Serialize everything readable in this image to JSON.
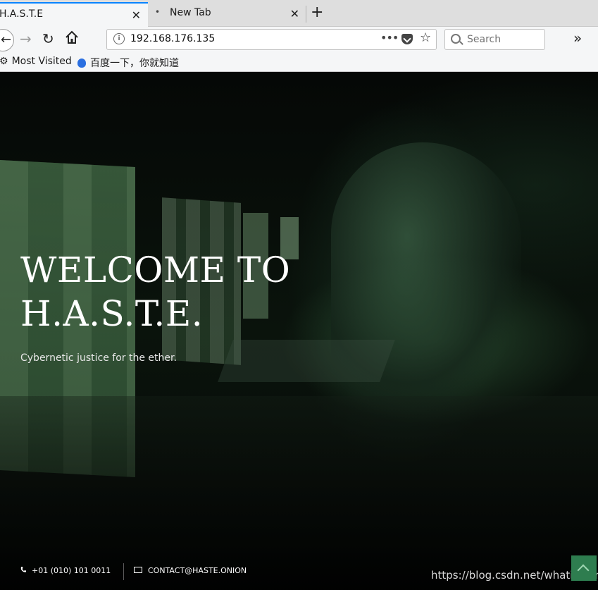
{
  "browser": {
    "tabs": [
      {
        "title": "H.A.S.T.E",
        "close": "✕"
      },
      {
        "title": "New Tab",
        "close": "✕",
        "indicator": "•"
      }
    ],
    "new_tab": "+",
    "nav": {
      "back": "←",
      "forward": "→",
      "reload": "↻",
      "overflow": "»"
    },
    "url": "192.168.176.135",
    "page_actions": "•••",
    "bookmark_star": "☆",
    "search_placeholder": "Search",
    "bookmarks": [
      {
        "label": "Most Visited",
        "icon": "gear-icon"
      },
      {
        "label": "百度一下，你就知道",
        "icon": "baidu-paw-icon"
      }
    ]
  },
  "hero": {
    "heading_line1": "WELCOME TO",
    "heading_line2": "H.A.S.T.E.",
    "tagline": "Cybernetic justice for the ether."
  },
  "footer": {
    "phone": "+01 (010) 101 0011",
    "email": "CONTACT@HASTE.ONION",
    "watermark": "https://blog.csdn.net/whatiwhere"
  },
  "colors": {
    "accent_tab": "#0a84ff",
    "scroll_top": "#2e7d4f"
  }
}
